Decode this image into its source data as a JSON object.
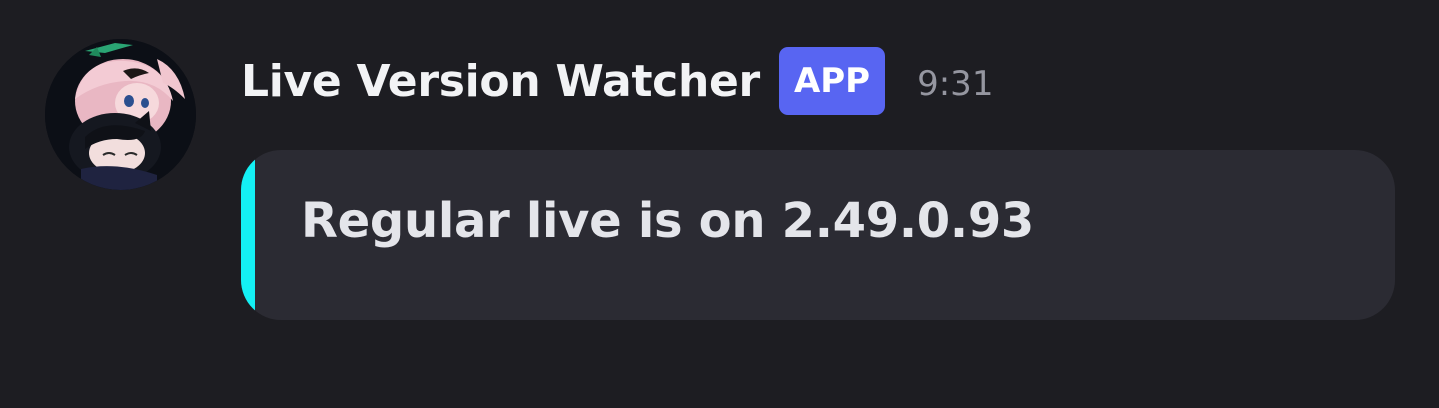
{
  "message": {
    "author": "Live Version Watcher",
    "badge": "APP",
    "timestamp": "9:31",
    "avatar_icon": "anime-characters-avatar",
    "embed": {
      "text": "Regular live is on 2.49.0.93",
      "accent_color": "#14f0f4"
    }
  },
  "colors": {
    "background": "#1d1d22",
    "embed_background": "#2b2b33",
    "badge_background": "#5865f2",
    "username": "#f2f3f5",
    "timestamp": "#9596a0"
  }
}
